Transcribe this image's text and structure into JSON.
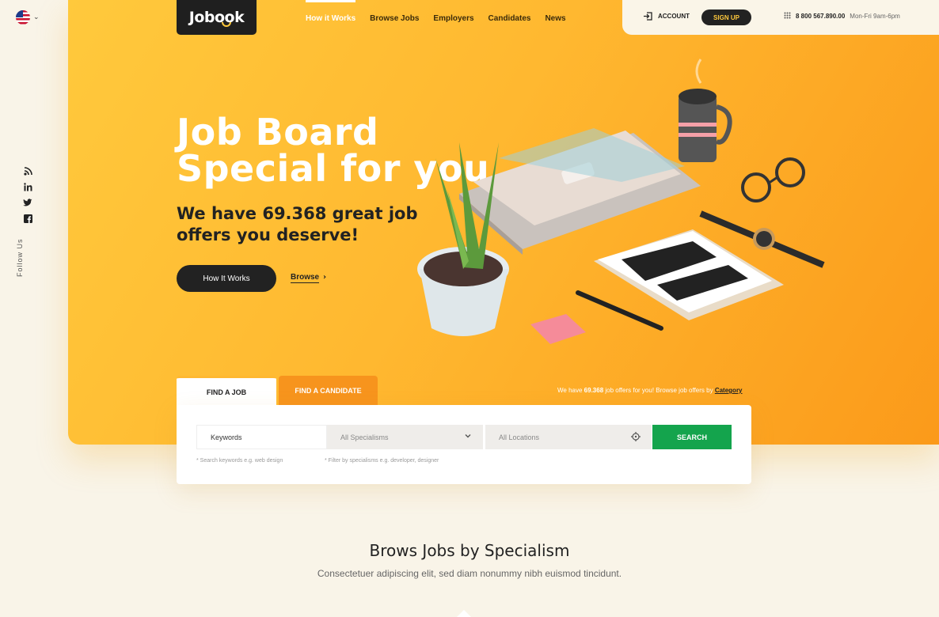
{
  "brand": {
    "logo_text": "Jobook"
  },
  "nav": [
    {
      "label": "How it Works",
      "active": true
    },
    {
      "label": "Browse Jobs",
      "active": false
    },
    {
      "label": "Employers",
      "active": false
    },
    {
      "label": "Candidates",
      "active": false
    },
    {
      "label": "News",
      "active": false
    }
  ],
  "topbar": {
    "account_label": "ACCOUNT",
    "signup_label": "SIGN UP",
    "phone": "8 800 567.890.00",
    "hours": "Mon-Fri 9am-6pm"
  },
  "sidebar": {
    "language_icon": "us-flag-icon",
    "social_icons": [
      "rss-icon",
      "linkedin-icon",
      "twitter-icon",
      "facebook-icon"
    ],
    "follow_label": "Follow Us"
  },
  "hero": {
    "title_line1": "Job Board",
    "title_line2": "Special for you",
    "subtitle_line1": "We have 69.368 great job",
    "subtitle_line2": "offers you deserve!",
    "cta_label": "How It Works",
    "browse_label": "Browse"
  },
  "search": {
    "tabs": [
      {
        "label": "FIND A JOB",
        "active": true
      },
      {
        "label": "FIND A CANDIDATE",
        "active": false
      }
    ],
    "offers_prefix": "We have",
    "offers_count": "69.368",
    "offers_middle": "job offers for you! Browse job offers by",
    "offers_link": "Category",
    "keywords_placeholder": "Keywords",
    "specialisms_value": "All Specialisms",
    "locations_value": "All Locations",
    "button_label": "SEARCH",
    "keywords_hint": "* Search keywords e.g. web design",
    "specialisms_hint": "* Filter by specialisms e.g. developer, designer"
  },
  "section": {
    "title": "Brows Jobs by Specialism",
    "subtitle": "Consectetuer adipiscing elit, sed diam nonummy nibh euismod tincidunt."
  },
  "colors": {
    "hero_start": "#ffc93c",
    "hero_end": "#fb9a1a",
    "search_button": "#14a44d",
    "dark": "#222222",
    "candidate_tab": "#f7941d"
  }
}
